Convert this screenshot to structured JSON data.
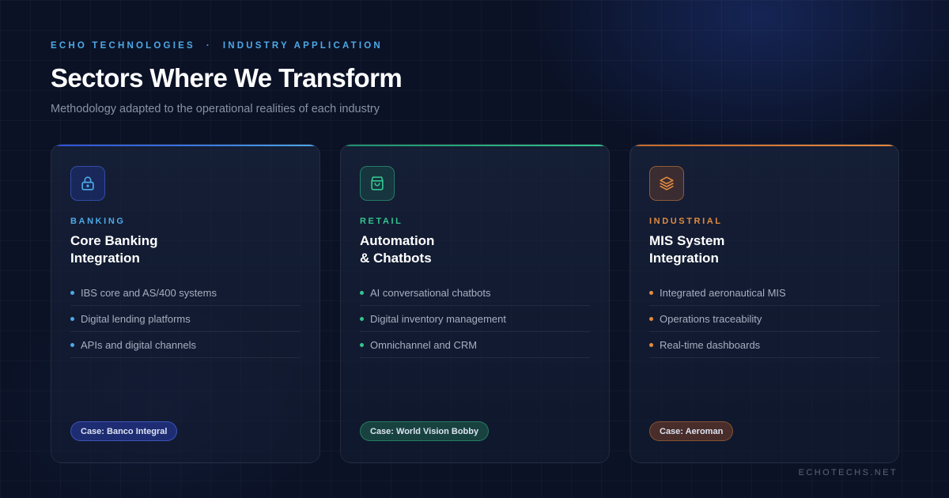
{
  "header": {
    "brand": "ECHO TECHNOLOGIES",
    "separator": "·",
    "section": "INDUSTRY APPLICATION",
    "title": "Sectors Where We Transform",
    "subtitle": "Methodology adapted to the operational realities of each industry"
  },
  "cards": [
    {
      "icon": "lock-icon",
      "accent": "#4ea9e6",
      "sector": "BANKING",
      "title": "Core Banking\nIntegration",
      "items": [
        "IBS core and AS/400 systems",
        "Digital lending platforms",
        "APIs and digital channels"
      ],
      "case": "Case: Banco Integral"
    },
    {
      "icon": "shopping-bag-icon",
      "accent": "#34c38f",
      "sector": "RETAIL",
      "title": "Automation\n& Chatbots",
      "items": [
        "AI conversational chatbots",
        "Digital inventory management",
        "Omnichannel and CRM"
      ],
      "case": "Case: World Vision Bobby"
    },
    {
      "icon": "layers-icon",
      "accent": "#e38a3f",
      "sector": "INDUSTRIAL",
      "title": "MIS System\nIntegration",
      "items": [
        "Integrated aeronautical MIS",
        "Operations traceability",
        "Real-time dashboards"
      ],
      "case": "Case: Aeroman"
    }
  ],
  "footer": {
    "site": "ECHOTECHS.NET"
  }
}
